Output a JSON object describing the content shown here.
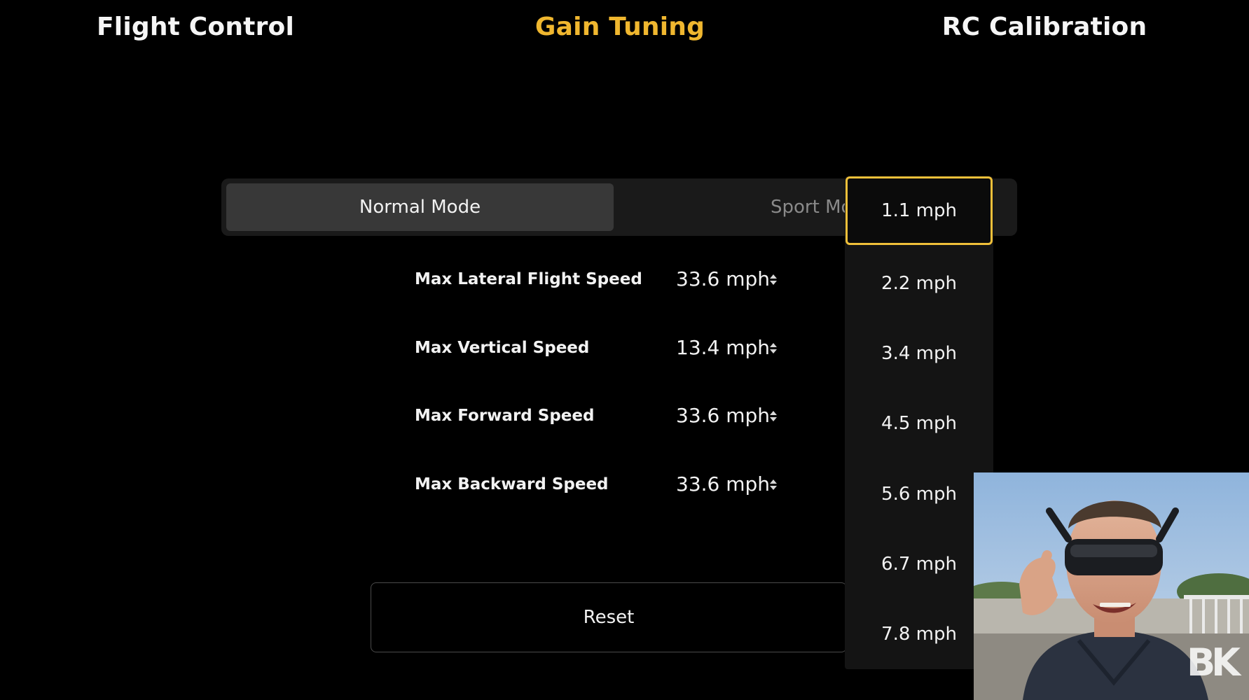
{
  "tabs": [
    {
      "label": "Flight Control",
      "active": false
    },
    {
      "label": "Gain Tuning",
      "active": true
    },
    {
      "label": "RC Calibration",
      "active": false
    }
  ],
  "colors": {
    "accent": "#f0b72f",
    "background": "#000000"
  },
  "modes": {
    "selected": "Normal Mode",
    "other": "Sport Mode"
  },
  "settings": [
    {
      "label": "Max Lateral Flight Speed",
      "value": "33.6 mph"
    },
    {
      "label": "Max Vertical Speed",
      "value": "13.4 mph"
    },
    {
      "label": "Max Forward Speed",
      "value": "33.6 mph"
    },
    {
      "label": "Max Backward Speed",
      "value": "33.6 mph"
    }
  ],
  "reset_label": "Reset",
  "picker": {
    "options": [
      "1.1 mph",
      "2.2 mph",
      "3.4 mph",
      "4.5 mph",
      "5.6 mph",
      "6.7 mph",
      "7.8 mph"
    ],
    "selected": "1.1 mph"
  },
  "webcam": {
    "description_icon": "presenter-webcam",
    "logo": "BK"
  }
}
